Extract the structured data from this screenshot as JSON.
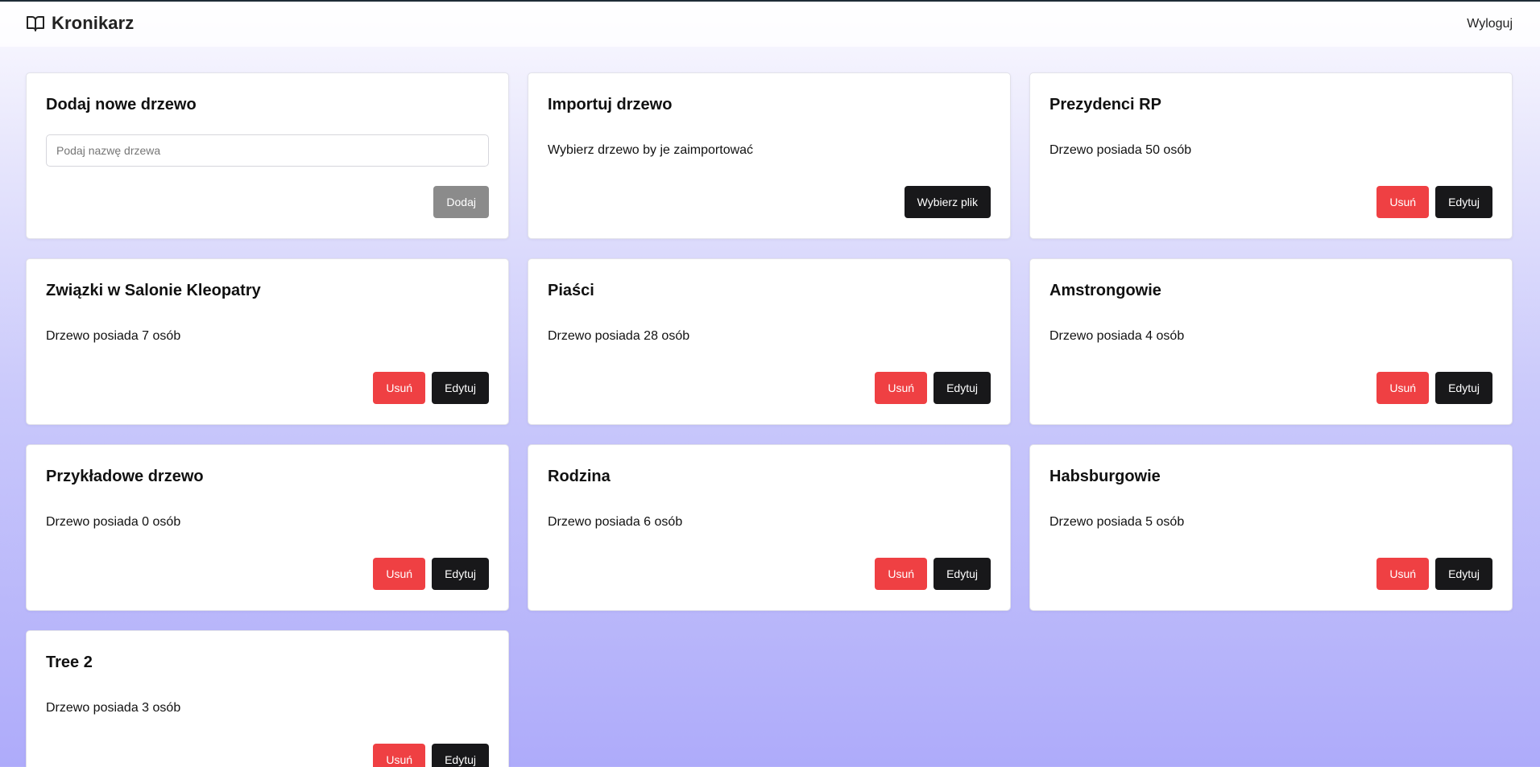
{
  "app": {
    "name": "Kronikarz",
    "logo_icon": "open-book-icon",
    "logout_label": "Wyloguj"
  },
  "add_card": {
    "title": "Dodaj nowe drzewo",
    "input_placeholder": "Podaj nazwę drzewa",
    "input_value": "",
    "add_label": "Dodaj"
  },
  "import_card": {
    "title": "Importuj drzewo",
    "description": "Wybierz drzewo by je zaimportować",
    "choose_file_label": "Wybierz plik"
  },
  "trees": [
    {
      "name": "Prezydenci RP",
      "info": "Drzewo posiada 50 osób",
      "delete_label": "Usuń",
      "edit_label": "Edytuj"
    },
    {
      "name": "Związki w Salonie Kleopatry",
      "info": "Drzewo posiada 7 osób",
      "delete_label": "Usuń",
      "edit_label": "Edytuj"
    },
    {
      "name": "Piaści",
      "info": "Drzewo posiada 28 osób",
      "delete_label": "Usuń",
      "edit_label": "Edytuj"
    },
    {
      "name": "Amstrongowie",
      "info": "Drzewo posiada 4 osób",
      "delete_label": "Usuń",
      "edit_label": "Edytuj"
    },
    {
      "name": "Przykładowe drzewo",
      "info": "Drzewo posiada 0 osób",
      "delete_label": "Usuń",
      "edit_label": "Edytuj"
    },
    {
      "name": "Rodzina",
      "info": "Drzewo posiada 6 osób",
      "delete_label": "Usuń",
      "edit_label": "Edytuj"
    },
    {
      "name": "Habsburgowie",
      "info": "Drzewo posiada 5 osób",
      "delete_label": "Usuń",
      "edit_label": "Edytuj"
    },
    {
      "name": "Tree 2",
      "info": "Drzewo posiada 3 osób",
      "delete_label": "Usuń",
      "edit_label": "Edytuj"
    }
  ],
  "colors": {
    "delete_button": "#ef4043",
    "primary_button": "#18181a",
    "disabled_button": "#8b8b8b"
  }
}
